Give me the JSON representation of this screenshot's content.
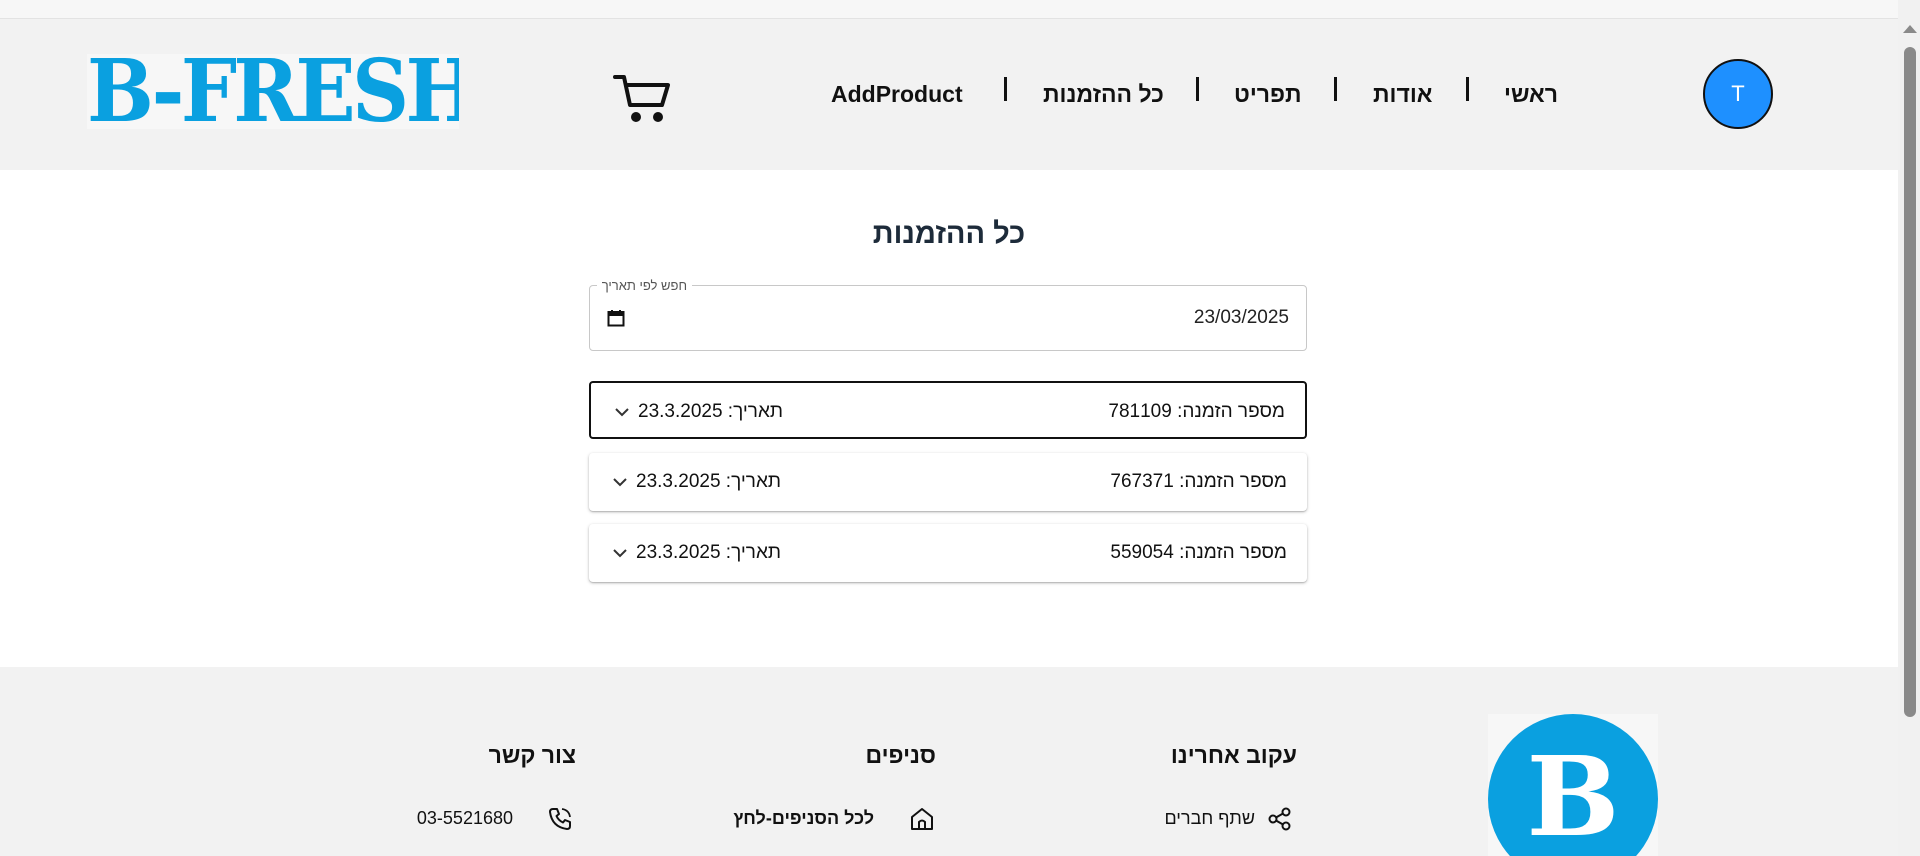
{
  "header": {
    "logo_text": "B-FRESH",
    "nav": [
      "AddProduct",
      "כל ההזמנות",
      "תפריט",
      "אודות",
      "ראשי"
    ],
    "avatar_initial": "T",
    "colors": {
      "brand": "#0aa0e0",
      "avatar": "#1e90ff",
      "navbar_bg": "#f2f2f2"
    }
  },
  "main": {
    "title": "כל ההזמנות",
    "date_filter": {
      "label": "חפש לפי תאריך",
      "value": "23/03/2025"
    },
    "orders": [
      {
        "number_label": "מספר הזמנה: 781109",
        "date_label": "תאריך: 23.3.2025",
        "selected": true
      },
      {
        "number_label": "מספר הזמנה: 767371",
        "date_label": "תאריך: 23.3.2025",
        "selected": false
      },
      {
        "number_label": "מספר הזמנה: 559054",
        "date_label": "תאריך: 23.3.2025",
        "selected": false
      }
    ]
  },
  "footer": {
    "follow": {
      "title": "עקוב אחרינו",
      "share_label": "שתף חברים"
    },
    "branches": {
      "title": "סניפים",
      "all_branches_label": "לכל הסניפים-לחץ"
    },
    "contact": {
      "title": "צור קשר",
      "phone": "03-5521680"
    },
    "logo_letter": "B"
  }
}
